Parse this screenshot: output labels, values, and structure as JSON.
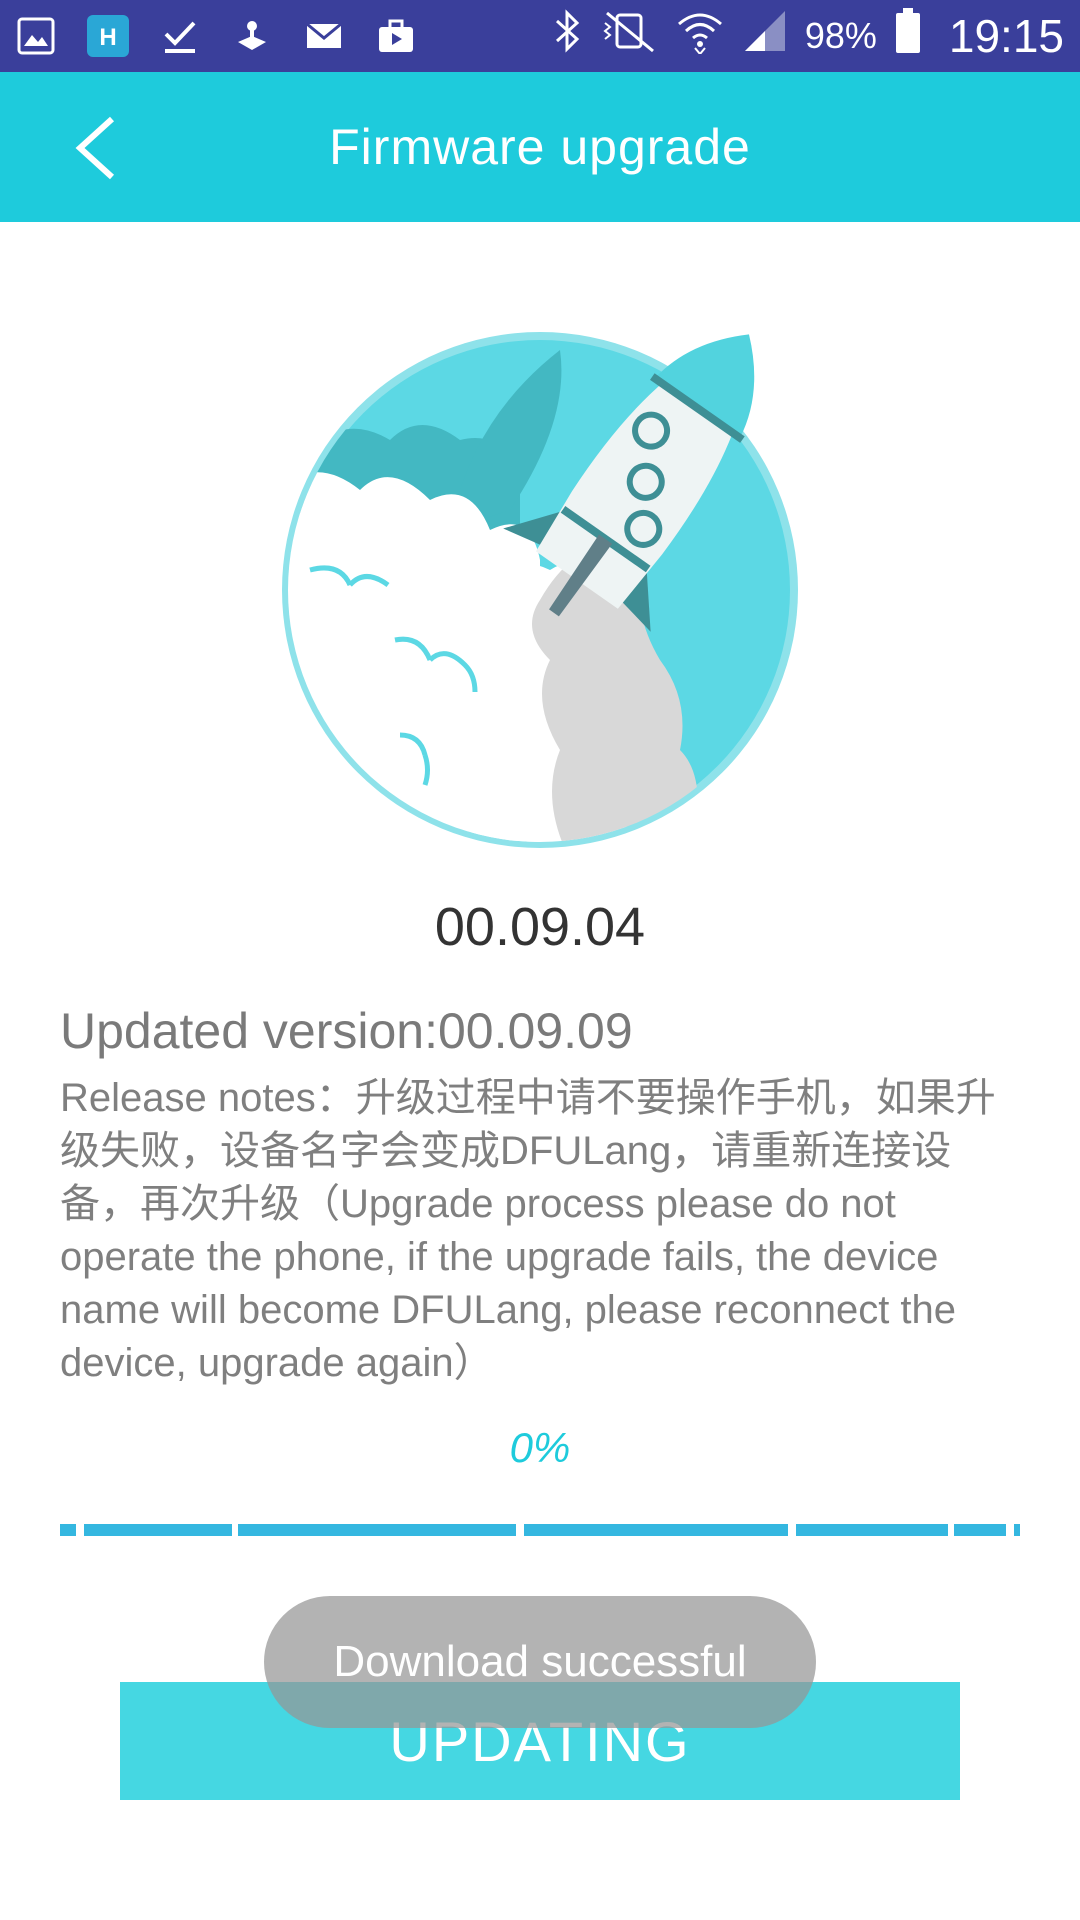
{
  "status_bar": {
    "left_icons": [
      "gallery-icon",
      "app-icon",
      "download-done-icon",
      "game-icon",
      "mail-icon",
      "briefcase-icon"
    ],
    "right_icons": [
      "bluetooth-icon",
      "vibrate-mute-icon",
      "wifi-icon",
      "signal-icon",
      "battery-icon"
    ],
    "battery_percent": "98%",
    "time": "19:15"
  },
  "app_bar": {
    "title": "Firmware upgrade",
    "back_icon": "chevron-left-icon",
    "background_color": "#1ecbdc"
  },
  "illustration": {
    "icon": "rocket-launch-illustration"
  },
  "firmware": {
    "current_version": "00.09.04",
    "updated_version": "Updated version:00.09.09",
    "release_notes": "Release notes：升级过程中请不要操作手机，如果升级失败，设备名字会变成DFULang，请重新连接设备，再次升级（Upgrade process please do not operate the phone, if the upgrade fails, the device name will become DFULang, please reconnect the device, upgrade again）"
  },
  "progress": {
    "label": "0%",
    "value": 0,
    "accent_color": "#1ecbdc",
    "bar_color": "#34b7e0"
  },
  "action": {
    "button_label": "UPDATING",
    "button_color": "#45d7e2"
  },
  "toast": {
    "message": "Download successful"
  }
}
